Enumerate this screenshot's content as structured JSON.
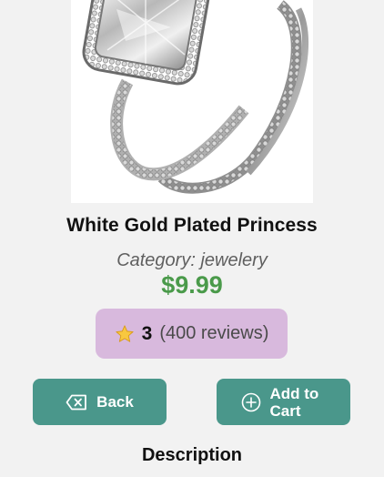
{
  "product": {
    "image_alt": "White Gold Plated Princess",
    "title": "White Gold Plated Princess",
    "category": "Category: jewelery",
    "price": "$9.99"
  },
  "rating": {
    "icon": "star-icon",
    "value": "3",
    "reviews": "(400 reviews)"
  },
  "actions": {
    "back_label": "Back",
    "back_icon": "backspace-icon",
    "add_to_cart_label": "Add to Cart",
    "add_icon": "plus-circle-icon"
  },
  "sections": {
    "description_heading": "Description"
  },
  "colors": {
    "background": "#f2f2f2",
    "price": "#4a9a4a",
    "rating_box": "#d8b9dd",
    "button": "#4a978b",
    "button_text": "#ffffff"
  }
}
